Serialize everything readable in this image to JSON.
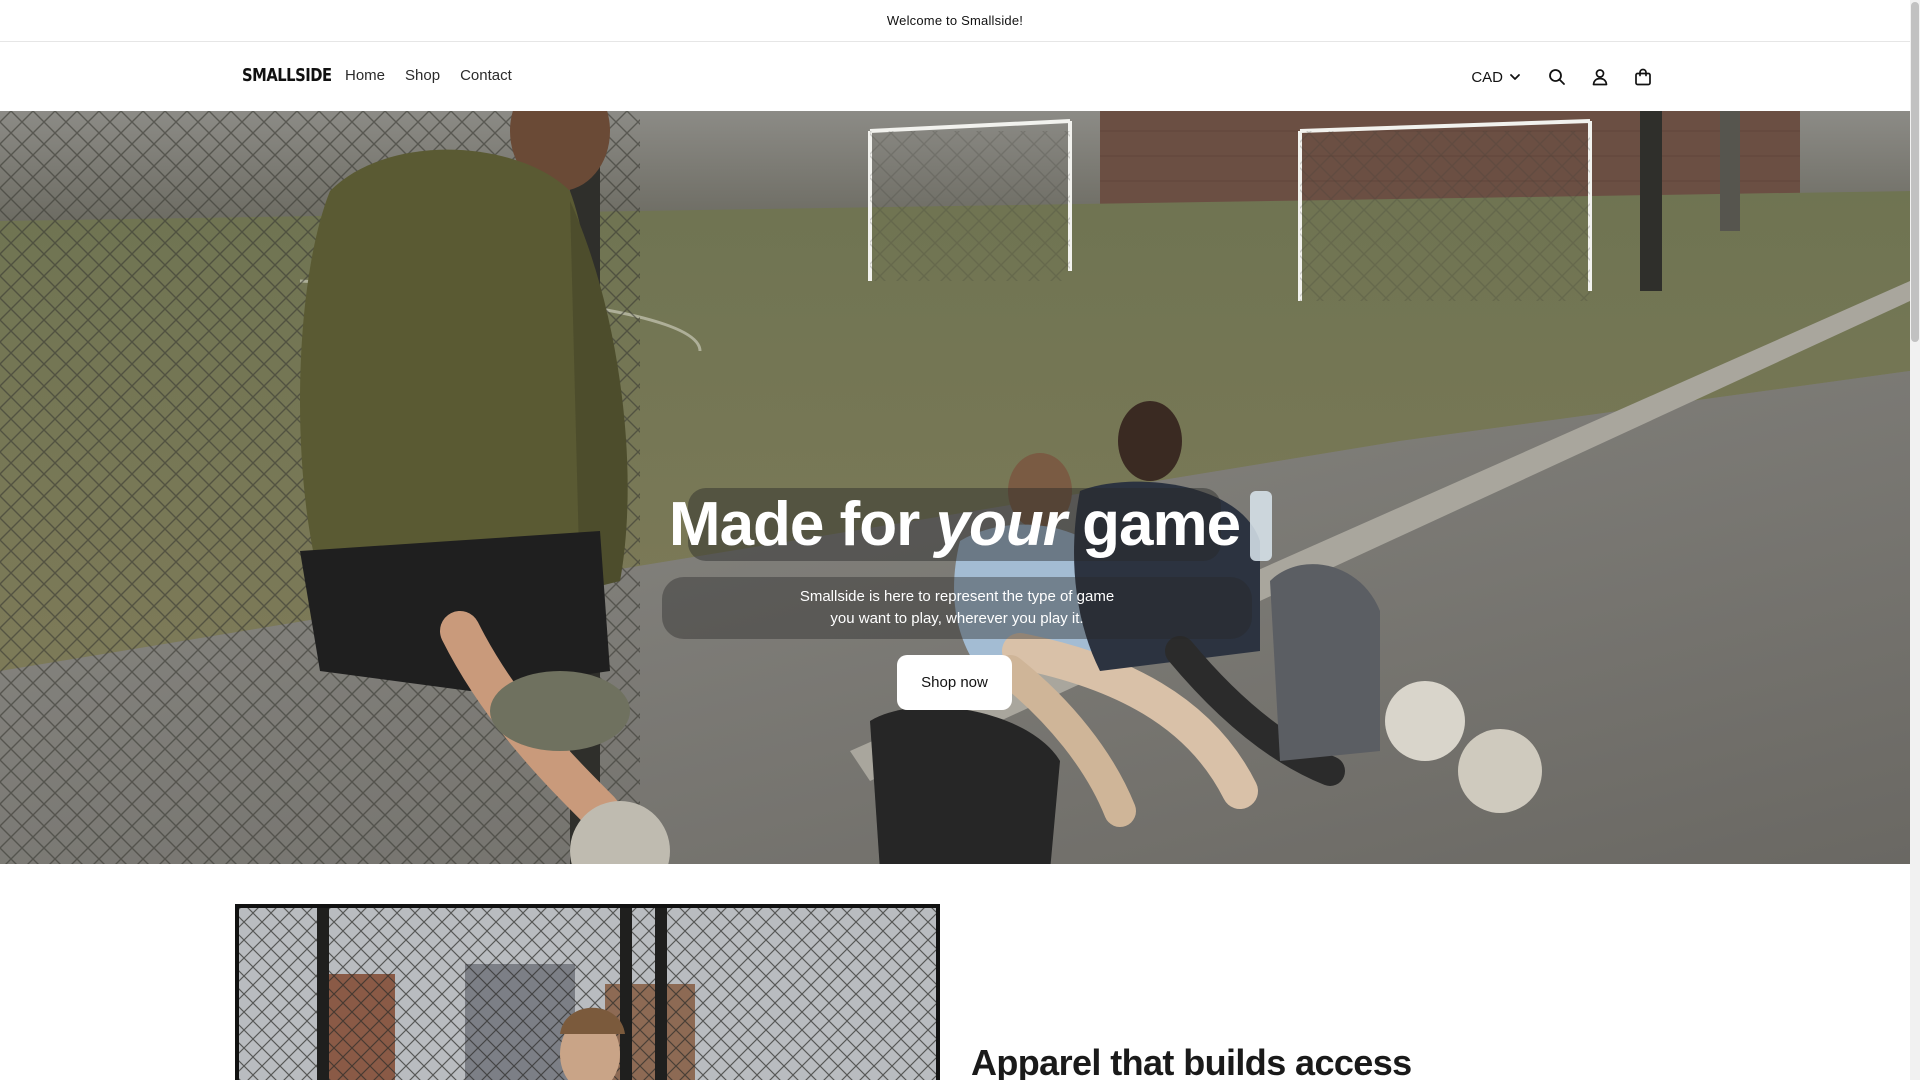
{
  "announcement": {
    "text": "Welcome to Smallside!"
  },
  "header": {
    "logo": "SMALLSIDE",
    "nav": [
      {
        "label": "Home"
      },
      {
        "label": "Shop"
      },
      {
        "label": "Contact"
      }
    ],
    "currency": "CAD",
    "icons": [
      "search-icon",
      "account-icon",
      "cart-icon"
    ]
  },
  "hero": {
    "title_start": "Made for ",
    "title_emphasis": "your",
    "title_end": " game",
    "subtitle": "Smallside is here to represent the type of game you want to play, wherever you play it.",
    "button_label": "Shop now"
  },
  "feature": {
    "heading": "Apparel that builds access"
  },
  "colors": {
    "text": "#121212",
    "button_bg": "#ffffff",
    "hoodie": "#5a5a33"
  }
}
